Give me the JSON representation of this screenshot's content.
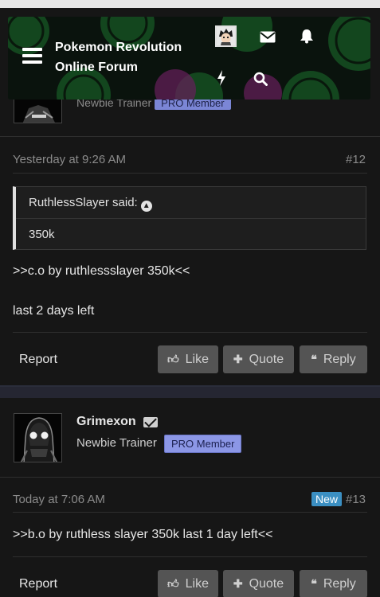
{
  "header": {
    "title_line1": "Pokemon Revolution",
    "title_line2": "Online Forum",
    "icons": [
      "menu-icon",
      "user-avatar",
      "mail-icon",
      "bell-icon",
      "lightning-icon",
      "search-icon"
    ]
  },
  "post12": {
    "user_title_partial": "Newbie Trainer",
    "badge_partial": "PRO Member",
    "date": "Yesterday at 9:26 AM",
    "number": "#12",
    "quote_author": "RuthlessSlayer said:",
    "quote_text": "350k",
    "message_line1": ">>c.o by ruthlessslayer 350k<<",
    "message_line2": "last 2 days left",
    "report": "Report",
    "like": "Like",
    "quote": "Quote",
    "reply": "Reply"
  },
  "post13": {
    "username": "Grimexon",
    "user_title": "Newbie Trainer",
    "badge": "PRO Member",
    "date": "Today at 7:06 AM",
    "new_badge": "New",
    "number": "#13",
    "message": ">>b.o by ruthless slayer 350k last 1 day left<<",
    "report": "Report",
    "like": "Like",
    "quote": "Quote",
    "reply": "Reply"
  },
  "colors": {
    "background": "#161616",
    "button": "#545454",
    "pro_badge": "#8c97e6",
    "new_badge": "#3b8fc2",
    "header_accent": "#2f8a3a"
  }
}
